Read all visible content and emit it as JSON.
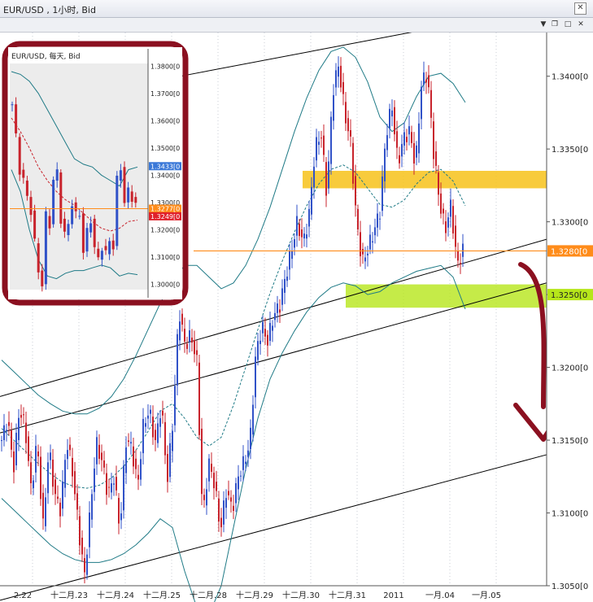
{
  "window": {
    "title": "EUR/USD , 1小时, Bid",
    "icons": [
      "close-icon",
      "chevron-down-icon",
      "restore-icon",
      "maximize-icon",
      "close-icon"
    ]
  },
  "colors": {
    "bull": "#3152c8",
    "bear": "#c8232c",
    "band": "#1f7a86",
    "ma": "#1f7a86",
    "price_line": "#ff8c1a",
    "resistance_zone": "#f7c21a",
    "support_zone": "#b6e61a",
    "arrow": "#8b1020",
    "frame": "#8b1020"
  },
  "chart_data": [
    {
      "type": "candlestick",
      "title": "EUR/USD , 1小时, Bid",
      "x_tick_labels": [
        "2.22",
        "十二月.23",
        "十二月.24",
        "十二月.25",
        "十二月.28",
        "十二月.29",
        "十二月.30",
        "十二月.31",
        "2011",
        "一月.04",
        "一月.05"
      ],
      "ylim": [
        1.305,
        1.343
      ],
      "y_tick_values": [
        1.305,
        1.31,
        1.315,
        1.32,
        1.325,
        1.33,
        1.335,
        1.34
      ],
      "y_tick_labels": [
        "1.3050[0",
        "1.3100[0",
        "1.3150[0",
        "1.3200[0",
        "1.3250[0",
        "1.3300[0",
        "1.3350[0",
        "1.3400[0"
      ],
      "current_price": 1.328,
      "current_price_label": "1.3280[0",
      "support_price": 1.325,
      "support_price_label": "1.3250[0",
      "resistance_zone": [
        1.3323,
        1.3335
      ],
      "support_zone": [
        1.3241,
        1.3257
      ],
      "close_path": [
        1.315,
        1.3165,
        1.313,
        1.3172,
        1.3158,
        1.3115,
        1.315,
        1.309,
        1.3145,
        1.3112,
        1.3102,
        1.315,
        1.3128,
        1.309,
        1.3056,
        1.3102,
        1.3148,
        1.3135,
        1.3112,
        1.3125,
        1.3088,
        1.315,
        1.3145,
        1.3118,
        1.3162,
        1.317,
        1.3148,
        1.3175,
        1.3122,
        1.3165,
        1.324,
        1.3215,
        1.3222,
        1.3205,
        1.3095,
        1.3135,
        1.312,
        1.3088,
        1.3116,
        1.3102,
        1.3125,
        1.3135,
        1.3148,
        1.321,
        1.3228,
        1.3218,
        1.3236,
        1.3242,
        1.3262,
        1.328,
        1.33,
        1.3285,
        1.3305,
        1.335,
        1.3362,
        1.3318,
        1.339,
        1.3408,
        1.3375,
        1.3355,
        1.33,
        1.3272,
        1.3282,
        1.3294,
        1.3308,
        1.336,
        1.338,
        1.334,
        1.3358,
        1.3362,
        1.3338,
        1.3395,
        1.3402,
        1.335,
        1.3315,
        1.3294,
        1.3312,
        1.327,
        1.328
      ],
      "bollinger_upper": [
        1.3205,
        1.3197,
        1.3189,
        1.3181,
        1.3175,
        1.317,
        1.3168,
        1.3168,
        1.3172,
        1.318,
        1.3192,
        1.3208,
        1.3226,
        1.3244,
        1.326,
        1.327,
        1.327,
        1.3262,
        1.3254,
        1.3258,
        1.327,
        1.3288,
        1.331,
        1.3336,
        1.3362,
        1.3385,
        1.3404,
        1.3417,
        1.342,
        1.3413,
        1.3396,
        1.3372,
        1.3362,
        1.3368,
        1.3386,
        1.34,
        1.3402,
        1.3395,
        1.3382
      ],
      "bollinger_lower": [
        1.311,
        1.3102,
        1.3094,
        1.3086,
        1.3078,
        1.3072,
        1.3068,
        1.3066,
        1.3066,
        1.3068,
        1.3072,
        1.3078,
        1.3086,
        1.3096,
        1.309,
        1.306,
        1.3035,
        1.303,
        1.305,
        1.309,
        1.313,
        1.3165,
        1.3192,
        1.321,
        1.3225,
        1.3238,
        1.3248,
        1.3255,
        1.3258,
        1.3256,
        1.325,
        1.3252,
        1.3258,
        1.3262,
        1.3266,
        1.3268,
        1.327,
        1.3262,
        1.324
      ],
      "bollinger_middle": [
        1.3158,
        1.315,
        1.3142,
        1.3134,
        1.3127,
        1.3121,
        1.3118,
        1.3117,
        1.3119,
        1.3124,
        1.3132,
        1.3143,
        1.3156,
        1.317,
        1.3175,
        1.3165,
        1.3152,
        1.3146,
        1.3152,
        1.3174,
        1.32,
        1.3226,
        1.3251,
        1.3273,
        1.3293,
        1.3311,
        1.3326,
        1.3336,
        1.3339,
        1.3334,
        1.3323,
        1.3312,
        1.331,
        1.3315,
        1.3326,
        1.3334,
        1.3336,
        1.3328,
        1.3311
      ],
      "trend_channel_lines": [
        {
          "x0": 0,
          "y0": 1.318,
          "x1": 1,
          "y1": 1.3288
        },
        {
          "x0": 0,
          "y0": 1.3155,
          "x1": 1,
          "y1": 1.3258
        },
        {
          "x0": 0,
          "y0": 1.304,
          "x1": 1,
          "y1": 1.314
        },
        {
          "x0": 0.33,
          "y0": 1.34,
          "x1": 0.82,
          "y1": 1.3435
        }
      ]
    },
    {
      "type": "candlestick",
      "title": "EUR/USD, 每天, Bid",
      "ylim": [
        1.298,
        1.381
      ],
      "y_tick_values": [
        1.3,
        1.31,
        1.32,
        1.33,
        1.34,
        1.35,
        1.36,
        1.37,
        1.38
      ],
      "y_tick_labels": [
        "1.3000[0",
        "1.3100[0",
        "1.3200[0",
        "1.3300[0",
        "1.3400[0",
        "1.3500[0",
        "1.3600[0",
        "1.3700[0",
        "1.3800[0"
      ],
      "price_box_top": "1.3433[0",
      "price_box_mid": "1.3277[0",
      "price_box_low": "1.3249[0",
      "close_path": [
        1.366,
        1.354,
        1.342,
        1.338,
        1.332,
        1.327,
        1.315,
        1.305,
        1.3,
        1.325,
        1.322,
        1.338,
        1.341,
        1.324,
        1.318,
        1.322,
        1.33,
        1.325,
        1.326,
        1.312,
        1.319,
        1.324,
        1.313,
        1.309,
        1.314,
        1.311,
        1.316,
        1.314,
        1.338,
        1.343,
        1.33,
        1.334,
        1.332,
        1.329
      ],
      "bollinger_upper": [
        1.378,
        1.377,
        1.3745,
        1.37,
        1.364,
        1.358,
        1.352,
        1.346,
        1.344,
        1.343,
        1.34,
        1.338,
        1.336,
        1.342,
        1.343
      ],
      "bollinger_lower": [
        1.342,
        1.334,
        1.32,
        1.309,
        1.303,
        1.302,
        1.304,
        1.305,
        1.305,
        1.306,
        1.307,
        1.306,
        1.303,
        1.304,
        1.3035
      ],
      "moving_average": [
        1.361,
        1.356,
        1.35,
        1.343,
        1.338,
        1.334,
        1.331,
        1.329,
        1.326,
        1.323,
        1.3205,
        1.3195,
        1.3205,
        1.323,
        1.3235
      ]
    }
  ]
}
